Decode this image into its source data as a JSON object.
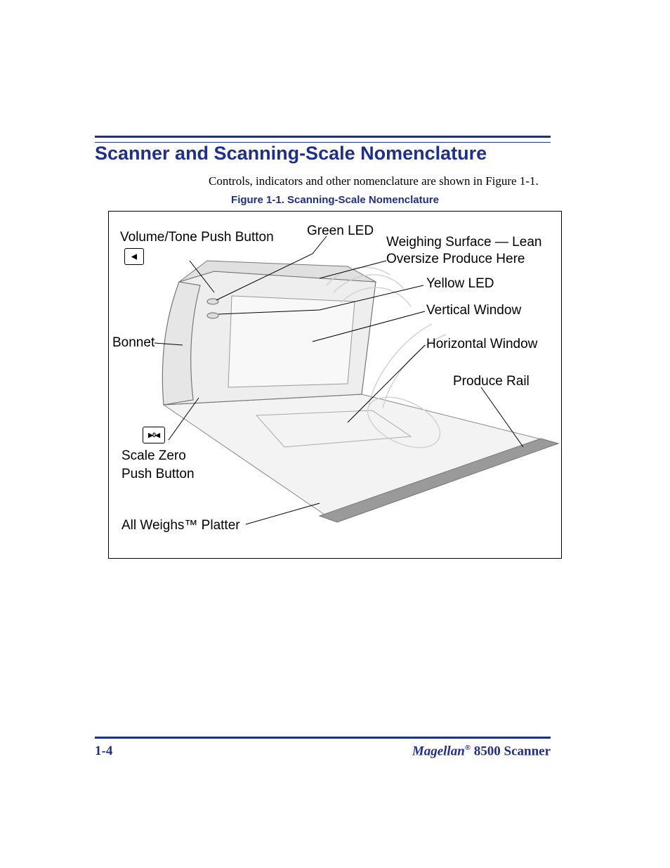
{
  "header": {
    "section_title": "Scanner and Scanning-Scale Nomenclature",
    "intro_text": "Controls, indicators and other nomenclature are shown in Figure 1-1.",
    "figure_caption": "Figure 1-1. Scanning-Scale Nomenclature"
  },
  "callouts": {
    "volume_tone": "Volume/Tone Push Button",
    "green_led": "Green LED",
    "weighing_surface_l1": "Weighing Surface — Lean",
    "weighing_surface_l2": "Oversize Produce Here",
    "yellow_led": "Yellow LED",
    "vertical_window": "Vertical Window",
    "bonnet": "Bonnet",
    "horizontal_window": "Horizontal Window",
    "produce_rail": "Produce Rail",
    "scale_zero_l1": "Scale Zero",
    "scale_zero_l2": "Push Button",
    "all_weighs": "All Weighs™ Platter"
  },
  "icons": {
    "volume_glyph": "◀",
    "scale_zero_glyph": "▶0◀"
  },
  "footer": {
    "page_number": "1-4",
    "brand": "Magellan",
    "reg": "®",
    "model": " 8500 Scanner"
  }
}
